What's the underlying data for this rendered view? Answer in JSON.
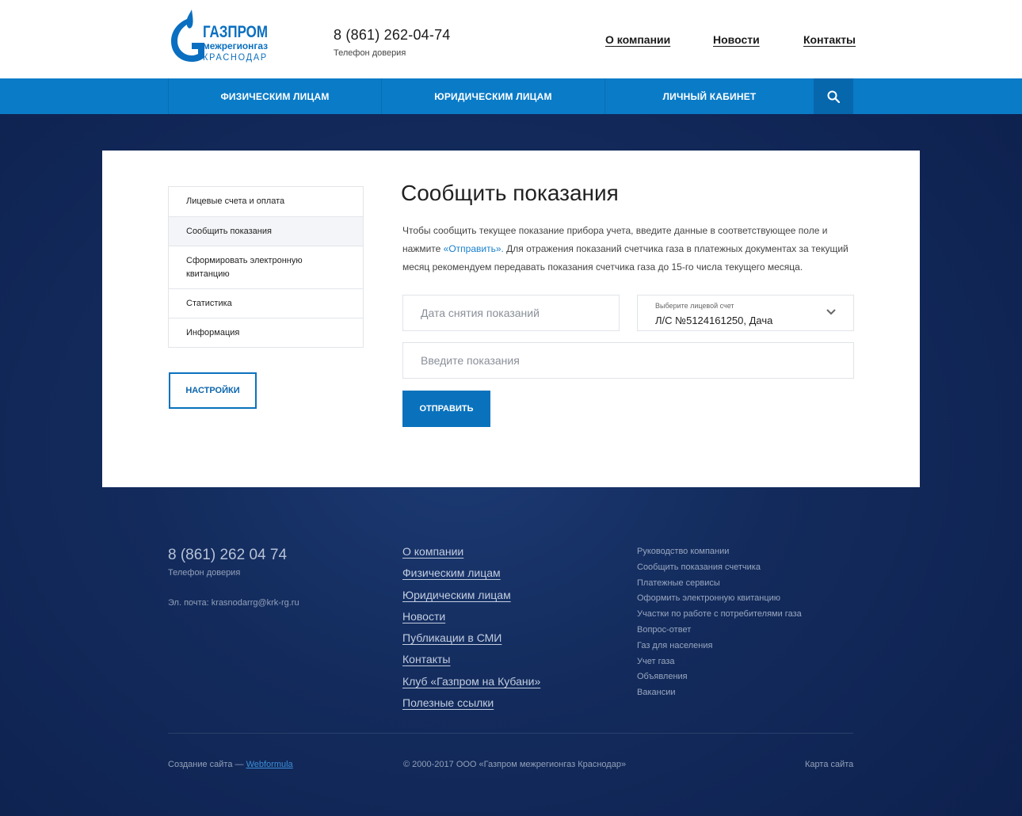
{
  "header": {
    "logo": {
      "line1": "ГАЗПРОМ",
      "line2": "межрегионгаз",
      "line3": "КРАСНОДАР"
    },
    "phone": "8 (861) 262-04-74",
    "phone_caption": "Телефон доверия",
    "links": [
      "О компании",
      "Новости",
      "Контакты"
    ]
  },
  "nav": {
    "items": [
      "ФИЗИЧЕСКИМ ЛИЦАМ",
      "ЮРИДИЧЕСКИМ ЛИЦАМ",
      "ЛИЧНЫЙ КАБИНЕТ"
    ],
    "search_icon": "search-icon"
  },
  "sidebar": {
    "items": [
      {
        "label": "Лицевые счета и оплата"
      },
      {
        "label": "Сообщить показания"
      },
      {
        "label": "Сформировать электронную квитанцию"
      },
      {
        "label": "Статистика"
      },
      {
        "label": "Информация"
      }
    ],
    "active_index": 1,
    "settings_label": "НАСТРОЙКИ"
  },
  "form": {
    "title": "Сообщить показания",
    "desc_before": "Чтобы сообщить текущее показание прибора учета, введите данные в соответствующее поле и нажмите ",
    "desc_link": "«Отправить».",
    "desc_after": " Для отражения показаний счетчика газа в платежных документах за текущий месяц рекомендуем передавать показания счетчика газа до 15-го числа текущего месяца.",
    "date_placeholder": "Дата снятия показаний",
    "account_label": "Выберите лицевой счет",
    "account_value": "Л/С №5124161250, Дача",
    "reading_placeholder": "Введите показания",
    "submit_label": "ОТПРАВИТЬ"
  },
  "footer": {
    "phone": "8 (861) 262 04 74",
    "phone_caption": "Телефон доверия",
    "email": "Эл. почта: krasnodarrg@krk-rg.ru",
    "col2": [
      "О компании",
      "Физическим лицам",
      "Юридическим лицам",
      "Новости",
      "Публикации в СМИ",
      "Контакты",
      "Клуб «Газпром на Кубани»",
      "Полезные ссылки"
    ],
    "col3": [
      "Руководство компании",
      "Сообщить показания счетчика",
      "Платежные сервисы",
      "Оформить электронную квитанцию",
      "Участки по работе с потребителями газа",
      "Вопрос-ответ",
      "Газ для населения",
      "Учет газа",
      "Объявления",
      "Вакансии"
    ],
    "credits_prefix": "Создание сайта — ",
    "credits_link": "Webformula",
    "copyright": "© 2000-2017 ООО «Газпром межрегионгаз Краснодар»",
    "sitemap": "Карта сайта"
  },
  "colors": {
    "brand_blue": "#0a7bc7",
    "nav_dark": "#0767ad",
    "footer_bg": "#132b5c"
  }
}
